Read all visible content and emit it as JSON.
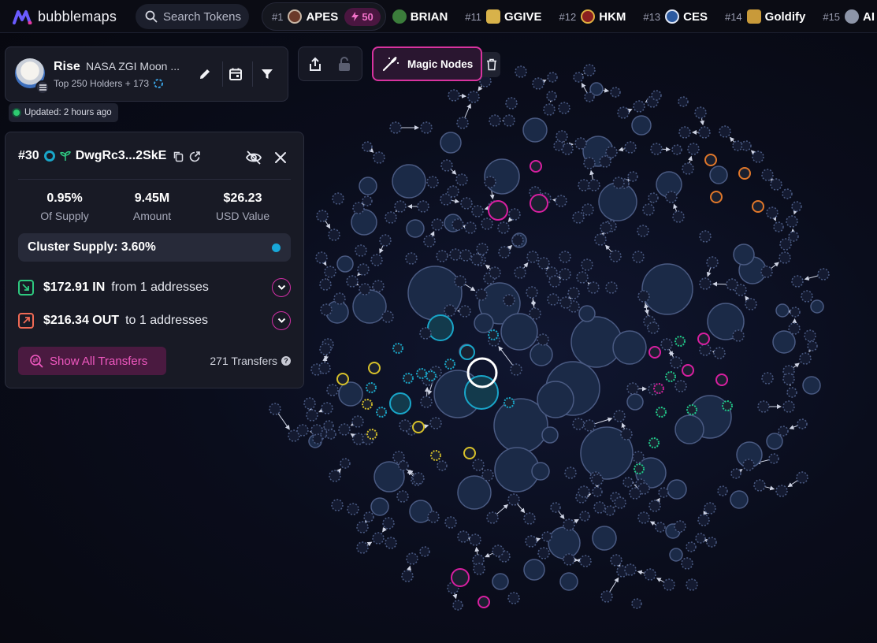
{
  "app": {
    "name": "bubblemaps"
  },
  "search": {
    "placeholder": "Search Tokens"
  },
  "ticker": {
    "first": {
      "rank": "#1",
      "name": "APES",
      "badge": "50",
      "icon_color": "#6b3a2a"
    },
    "items": [
      {
        "rank": "",
        "name": "BRIAN",
        "icon_color": "#3b7d3b"
      },
      {
        "rank": "#11",
        "name": "GGIVE",
        "icon_color": "#d8b24a"
      },
      {
        "rank": "#12",
        "name": "HKM",
        "icon_color": "#8a1f1f"
      },
      {
        "rank": "#13",
        "name": "CES",
        "icon_color": "#2c5aa0"
      },
      {
        "rank": "#14",
        "name": "Goldify",
        "icon_color": "#c89a3a"
      },
      {
        "rank": "#15",
        "name": "AI",
        "icon_color": "#8d95a8"
      }
    ]
  },
  "token": {
    "name": "Rise",
    "subtitle": "NASA ZGI Moon ...",
    "holders": "Top 250 Holders + 173",
    "updated": "Updated: 2 hours ago"
  },
  "toolbar": {
    "magic_label": "Magic Nodes"
  },
  "wallet": {
    "rank": "#30",
    "address": "DwgRc3...2SkE",
    "stats": [
      {
        "value": "0.95%",
        "label": "Of Supply"
      },
      {
        "value": "9.45M",
        "label": "Amount"
      },
      {
        "value": "$26.23",
        "label": "USD Value"
      }
    ],
    "cluster_supply": "Cluster Supply: 3.60%",
    "in": {
      "amount": "$172.91 IN",
      "text": "from 1 addresses"
    },
    "out": {
      "amount": "$216.34 OUT",
      "text": "to 1 addresses"
    },
    "show_all": "Show All Transfers",
    "transfers": "271 Transfers"
  },
  "colors": {
    "accent": "#d8339f",
    "node": "#1b2a47",
    "node_stroke": "#4a5a82",
    "teal": "#19a6c9",
    "magenta": "#d71fa0",
    "green": "#1fc98a",
    "yellow": "#d6c02a",
    "orange": "#e0772a"
  }
}
